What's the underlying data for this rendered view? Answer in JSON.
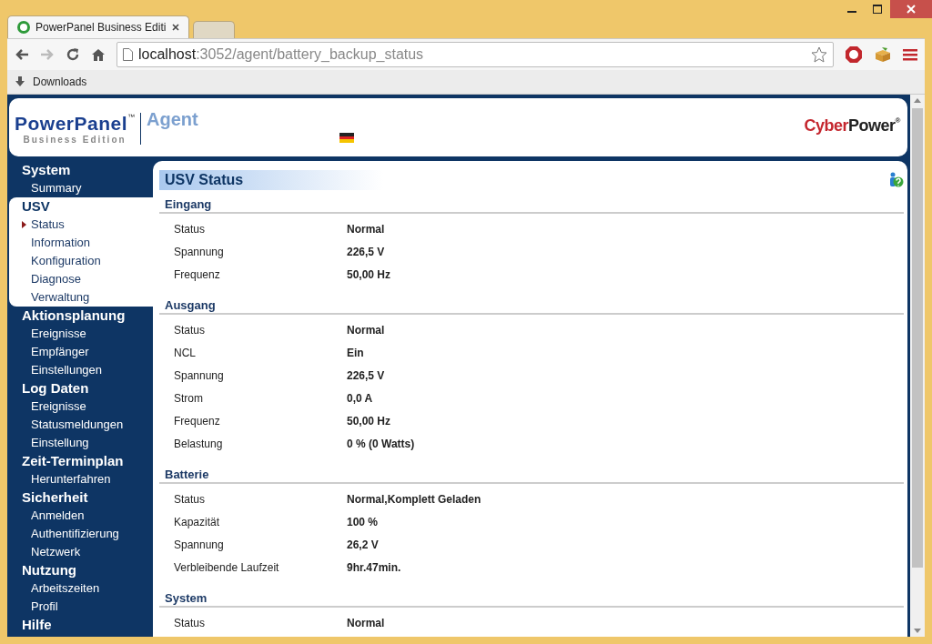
{
  "browser": {
    "tabs": [
      {
        "title": "PowerPanel Business Editi",
        "selected": true
      },
      {
        "selected": false
      }
    ],
    "url_host": "localhost",
    "url_rest": ":3052/agent/battery_backup_status",
    "bookmarks": [
      "Downloads"
    ]
  },
  "header": {
    "logo": "PowerPanel",
    "logo_tm": "™",
    "logo_sub": "Business Edition",
    "agent": "Agent",
    "brand_a": "Cyber",
    "brand_b": "Power",
    "brand_reg": "®"
  },
  "sidebar": [
    {
      "title": "System",
      "selected": false,
      "items": [
        {
          "label": "Summary",
          "selected": false
        }
      ]
    },
    {
      "title": "USV",
      "selected": true,
      "items": [
        {
          "label": "Status",
          "selected": true
        },
        {
          "label": "Information",
          "selected": false
        },
        {
          "label": "Konfiguration",
          "selected": false
        },
        {
          "label": "Diagnose",
          "selected": false
        },
        {
          "label": "Verwaltung",
          "selected": false
        }
      ]
    },
    {
      "title": "Aktionsplanung",
      "selected": false,
      "items": [
        {
          "label": "Ereignisse",
          "selected": false
        },
        {
          "label": "Empfänger",
          "selected": false
        },
        {
          "label": "Einstellungen",
          "selected": false
        }
      ]
    },
    {
      "title": "Log Daten",
      "selected": false,
      "items": [
        {
          "label": "Ereignisse",
          "selected": false
        },
        {
          "label": "Statusmeldungen",
          "selected": false
        },
        {
          "label": "Einstellung",
          "selected": false
        }
      ]
    },
    {
      "title": "Zeit-Terminplan",
      "selected": false,
      "items": [
        {
          "label": "Herunterfahren",
          "selected": false
        }
      ]
    },
    {
      "title": "Sicherheit",
      "selected": false,
      "items": [
        {
          "label": "Anmelden",
          "selected": false
        },
        {
          "label": "Authentifizierung",
          "selected": false
        },
        {
          "label": "Netzwerk",
          "selected": false
        }
      ]
    },
    {
      "title": "Nutzung",
      "selected": false,
      "items": [
        {
          "label": "Arbeitszeiten",
          "selected": false
        },
        {
          "label": "Profil",
          "selected": false
        }
      ]
    },
    {
      "title": "Hilfe",
      "selected": false
    }
  ],
  "content": {
    "title": "USV Status",
    "sections": [
      {
        "title": "Eingang",
        "rows": [
          {
            "label": "Status",
            "value": "Normal"
          },
          {
            "label": "Spannung",
            "value": "226,5 V"
          },
          {
            "label": "Frequenz",
            "value": "50,00 Hz"
          }
        ]
      },
      {
        "title": "Ausgang",
        "rows": [
          {
            "label": "Status",
            "value": "Normal"
          },
          {
            "label": "NCL",
            "value": "Ein"
          },
          {
            "label": "Spannung",
            "value": "226,5 V"
          },
          {
            "label": "Strom",
            "value": "0,0 A"
          },
          {
            "label": "Frequenz",
            "value": "50,00 Hz"
          },
          {
            "label": "Belastung",
            "value": "0 % (0 Watts)"
          }
        ]
      },
      {
        "title": "Batterie",
        "rows": [
          {
            "label": "Status",
            "value": "Normal,Komplett Geladen"
          },
          {
            "label": "Kapazität",
            "value": "100 %"
          },
          {
            "label": "Spannung",
            "value": "26,2 V"
          },
          {
            "label": "Verbleibende Laufzeit",
            "value": "9hr.47min."
          }
        ]
      },
      {
        "title": "System",
        "rows": [
          {
            "label": "Status",
            "value": "Normal"
          }
        ]
      }
    ]
  }
}
